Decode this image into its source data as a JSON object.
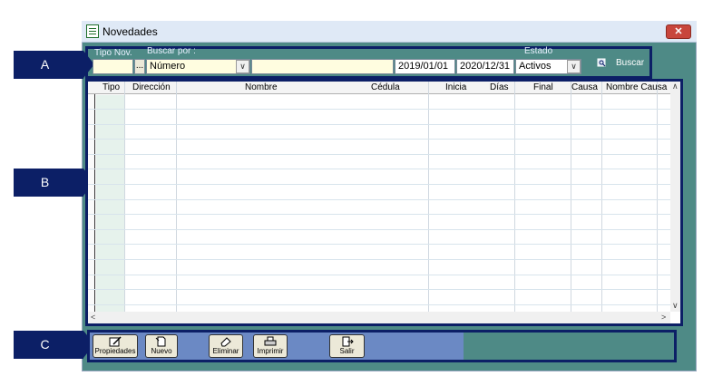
{
  "window": {
    "title": "Novedades",
    "close_icon": "close-icon"
  },
  "callouts": {
    "a": "A",
    "b": "B",
    "c": "C"
  },
  "filters": {
    "tipo_label": "Tipo Nov.",
    "buscar_label": "Buscar por :",
    "estado_label": "Estado",
    "tipo_value": "",
    "ellipsis": "...",
    "buscar_por_value": "Número",
    "buscar_text_value": "",
    "fecha_desde": "2019/01/01",
    "fecha_hasta": "2020/12/31",
    "estado_value": "Activos",
    "buscar_button": "Buscar"
  },
  "grid": {
    "columns": [
      "Tipo",
      "Dirección",
      "Nombre",
      "Cédula",
      "Inicia",
      "Días",
      "Final",
      "Causa",
      "Nombre Causa"
    ],
    "rows": []
  },
  "toolbar": {
    "propiedades": "Propiedades",
    "nuevo": "Nuevo",
    "eliminar": "Eliminar",
    "imprimir": "Imprimir",
    "salir": "Salir"
  },
  "colors": {
    "accent_navy": "#0c1f66",
    "teal": "#4e8a86",
    "field_yellow": "#fffde0",
    "toolbar_blue": "#6b89c4"
  }
}
